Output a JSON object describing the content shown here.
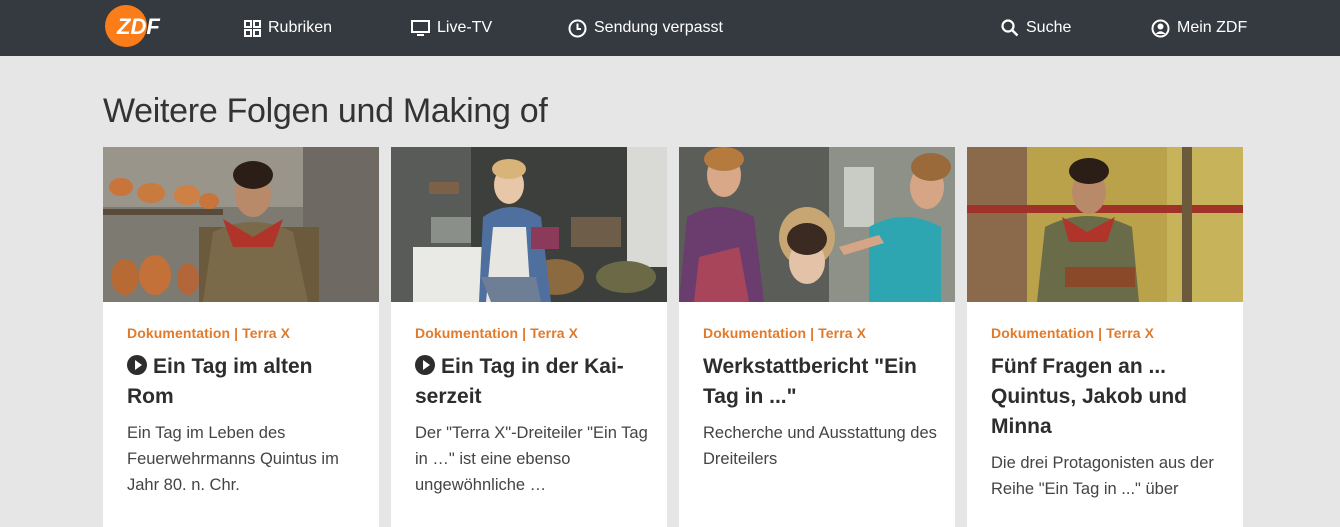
{
  "header": {
    "logo_text": "ZDF",
    "nav": {
      "rubriken": "Rubriken",
      "live_tv": "Live-TV",
      "sendung_verpasst": "Sendung verpasst",
      "suche": "Suche",
      "mein_zdf": "Mein ZDF"
    }
  },
  "section": {
    "title": "Weitere Folgen und Making of"
  },
  "cards": [
    {
      "category": "Dokumentation | Terra X",
      "title_line1": "Ein Tag im alten",
      "title_line2": "Rom",
      "title_line3": "",
      "has_play": true,
      "description": "Ein Tag im Leben des Feuerwehrmanns Quintus im Jahr 80. n. Chr."
    },
    {
      "category": "Dokumentation | Terra X",
      "title_line1": "Ein Tag in der Kai-",
      "title_line2": "serzeit",
      "title_line3": "",
      "has_play": true,
      "description": "Der \"Terra X\"-Dreiteiler \"Ein Tag in …\" ist eine ebenso ungewöhnliche …"
    },
    {
      "category": "Dokumentation | Terra X",
      "title_line1": "Werkstattbericht \"Ein",
      "title_line2": "Tag in ...\"",
      "title_line3": "",
      "has_play": false,
      "description": "Recherche und Ausstattung des Dreiteilers"
    },
    {
      "category": "Dokumentation | Terra X",
      "title_line1": "Fünf Fragen an ...",
      "title_line2": "Quintus, Jakob und",
      "title_line3": "Minna",
      "has_play": false,
      "description": "Die drei Protagonisten aus der Reihe \"Ein Tag in ...\" über"
    }
  ],
  "colors": {
    "header_bg": "#353a40",
    "accent_orange": "#fa7d19",
    "category_orange": "#e27a2b",
    "page_bg": "#e6e6e6"
  },
  "icons": {
    "rubriken": "grid-icon",
    "live_tv": "monitor-icon",
    "sendung_verpasst": "clock-icon",
    "suche": "search-icon",
    "mein_zdf": "user-circle-icon",
    "play": "play-circle-icon"
  }
}
